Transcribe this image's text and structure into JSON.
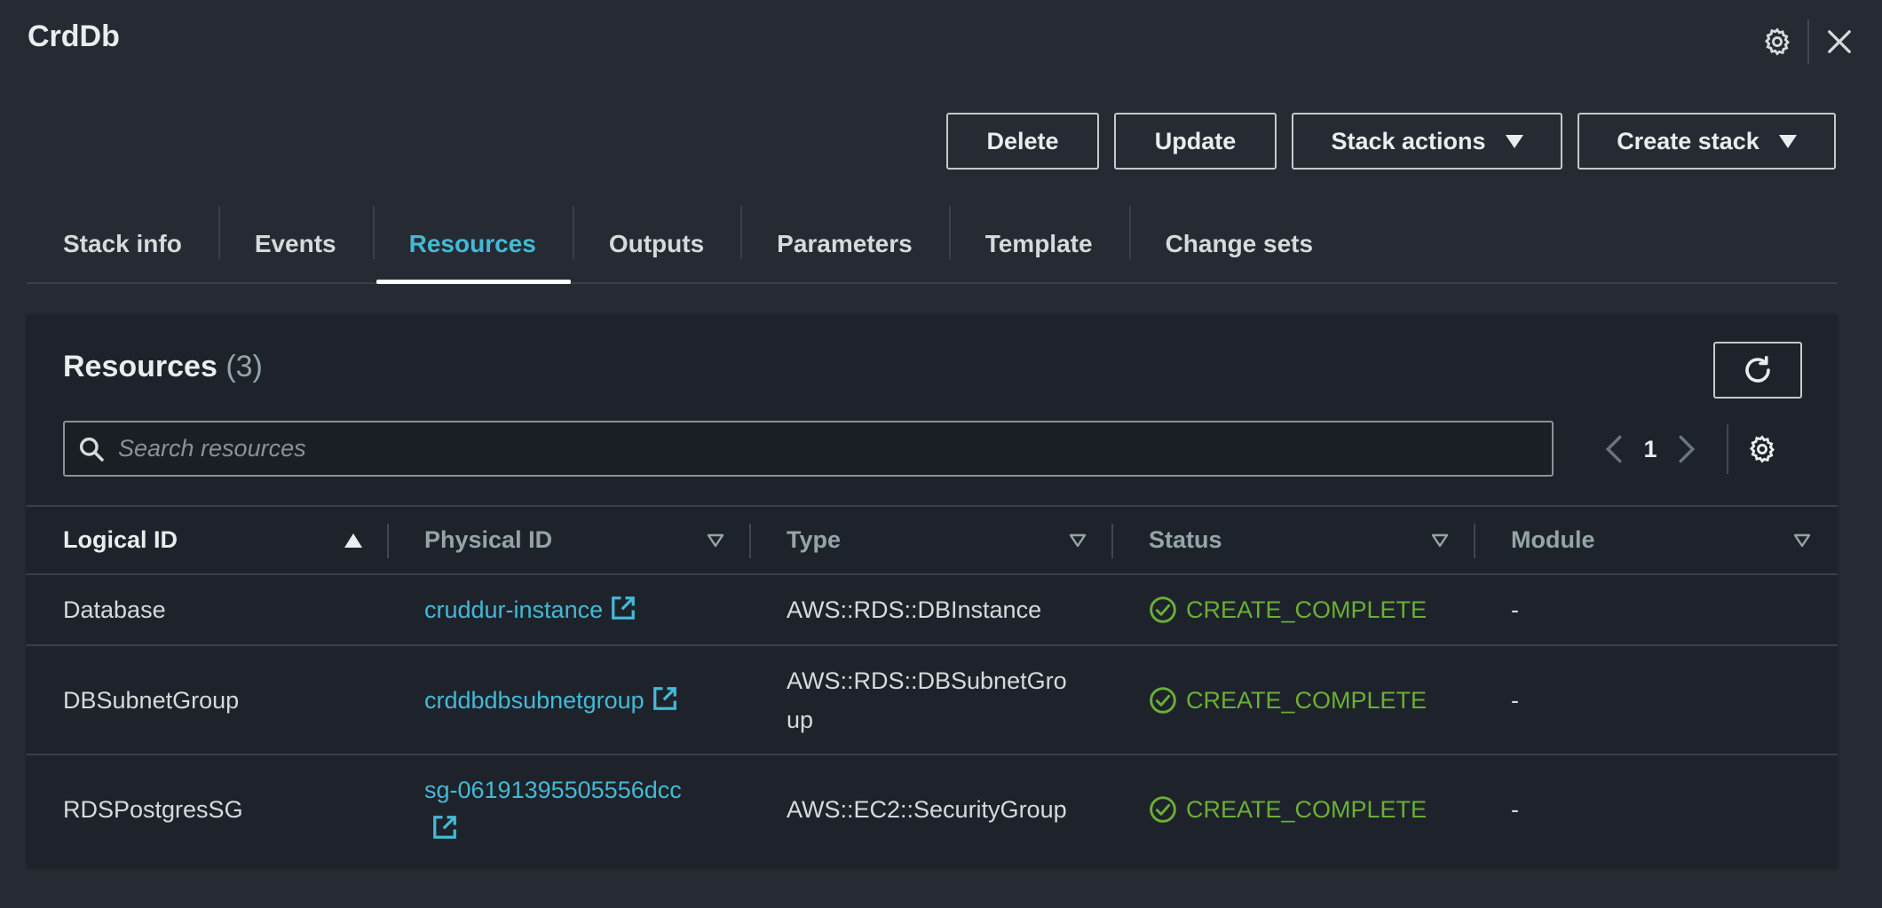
{
  "header": {
    "title": "CrdDb",
    "settings_icon": "gear-icon",
    "close_icon": "close-icon"
  },
  "actions": {
    "delete": "Delete",
    "update": "Update",
    "stack_actions": "Stack actions",
    "create_stack": "Create stack"
  },
  "tabs": [
    {
      "label": "Stack info"
    },
    {
      "label": "Events"
    },
    {
      "label": "Resources",
      "active": true
    },
    {
      "label": "Outputs"
    },
    {
      "label": "Parameters"
    },
    {
      "label": "Template"
    },
    {
      "label": "Change sets"
    }
  ],
  "resources": {
    "title": "Resources",
    "count": "(3)",
    "search_placeholder": "Search resources",
    "page": "1",
    "columns": [
      "Logical ID",
      "Physical ID",
      "Type",
      "Status",
      "Module"
    ],
    "rows": [
      {
        "logical_id": "Database",
        "physical_id": "cruddur-instance",
        "type": "AWS::RDS::DBInstance",
        "status": "CREATE_COMPLETE",
        "module": "-"
      },
      {
        "logical_id": "DBSubnetGroup",
        "physical_id": "crddbdbsubnetgroup",
        "type": "AWS::RDS::DBSubnetGro up",
        "status": "CREATE_COMPLETE",
        "module": "-"
      },
      {
        "logical_id": "RDSPostgresSG",
        "physical_id": "sg-06191395505556dcc",
        "type": "AWS::EC2::SecurityGroup",
        "status": "CREATE_COMPLETE",
        "module": "-"
      }
    ]
  },
  "colors": {
    "background": "#262b33",
    "panel": "#1e232b",
    "link": "#44b9d6",
    "success": "#6aaf35"
  }
}
